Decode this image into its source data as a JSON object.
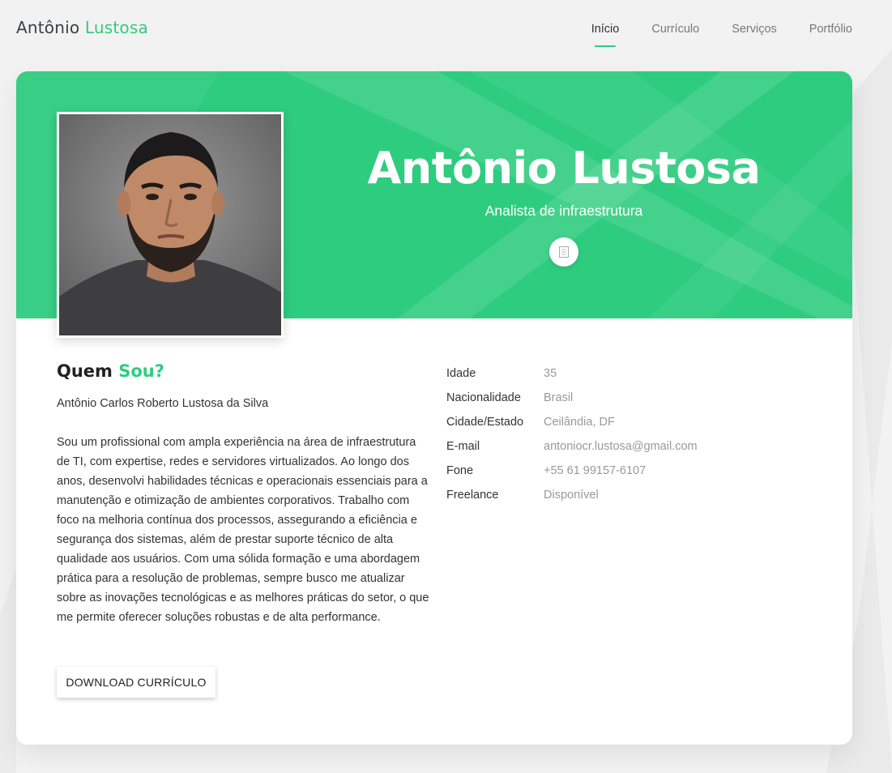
{
  "header": {
    "logo_first": "Antônio",
    "logo_second": "Lustosa",
    "nav": [
      {
        "label": "Início",
        "active": true
      },
      {
        "label": "Currículo",
        "active": false
      },
      {
        "label": "Serviços",
        "active": false
      },
      {
        "label": "Portfólio",
        "active": false
      }
    ]
  },
  "hero": {
    "name": "Antônio Lustosa",
    "role": "Analista de infraestrutura",
    "cv_icon": "document-icon",
    "photo_alt": "Antônio Lustosa"
  },
  "about": {
    "title_first": "Quem",
    "title_second": "Sou?",
    "full_name": "Antônio Carlos Roberto Lustosa da Silva",
    "bio": "Sou um profissional com ampla experiência na área de infraestrutura de TI, com expertise, redes e servidores virtualizados. Ao longo dos anos, desenvolvi habilidades técnicas e operacionais essenciais para a manutenção e otimização de ambientes corporativos. Trabalho com foco na melhoria contínua dos processos, assegurando a eficiência e segurança dos sistemas, além de prestar suporte técnico de alta qualidade aos usuários. Com uma sólida formação e uma abordagem prática para a resolução de problemas, sempre busco me atualizar sobre as inovações tecnológicas e as melhores práticas do setor, o que me permite oferecer soluções robustas e de alta performance.",
    "download_label": "DOWNLOAD CURRÍCULO"
  },
  "info": [
    {
      "label": "Idade",
      "value": "35"
    },
    {
      "label": "Nacionalidade",
      "value": "Brasil"
    },
    {
      "label": "Cidade/Estado",
      "value": "Ceilândia, DF"
    },
    {
      "label": "E-mail",
      "value": "antoniocr.lustosa@gmail.com"
    },
    {
      "label": "Fone",
      "value": "+55 61 99157-6107"
    },
    {
      "label": "Freelance",
      "value": "Disponível"
    }
  ],
  "colors": {
    "accent": "#2ecc7f",
    "background": "#f2f2f2",
    "card": "#ffffff"
  }
}
